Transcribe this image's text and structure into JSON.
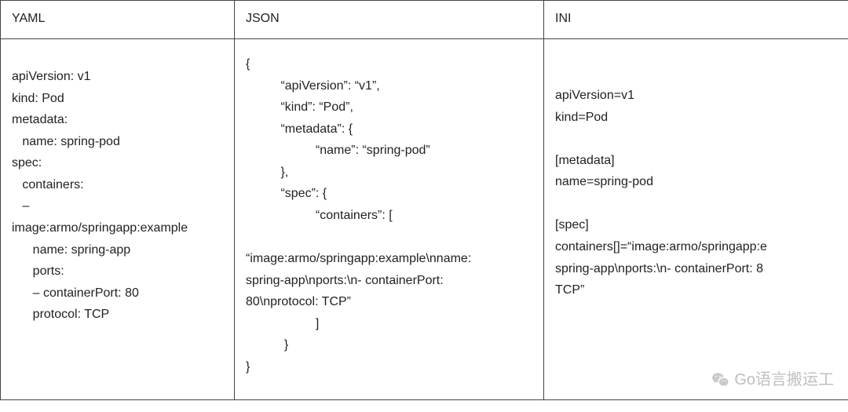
{
  "chart_data": {
    "type": "table",
    "columns": [
      "YAML",
      "JSON",
      "INI"
    ],
    "rows": [
      {
        "yaml": "apiVersion: v1\nkind: Pod\nmetadata:\n   name: spring-pod\nspec:\n   containers:\n   –\nimage:armo/springapp:example\n      name: spring-app\n      ports:\n      – containerPort: 80\n      protocol: TCP",
        "json": "{\n          “apiVersion”: “v1”,\n          “kind”: “Pod”,\n          “metadata”: {\n                    “name”: “spring-pod”\n          },\n          “spec”: {\n                    “containers”: [\n\n“image:armo/springapp:example\\nname:\nspring-app\\nports:\\n- containerPort:\n80\\nprotocol: TCP”\n                    ]\n           }\n}",
        "ini": "apiVersion=v1\nkind=Pod\n\n[metadata]\nname=spring-pod\n\n[spec]\ncontainers[]=“image:armo/springapp:e\nspring-app\\nports:\\n- containerPort: 8\nTCP”"
      }
    ]
  },
  "headers": {
    "col1": "YAML",
    "col2": "JSON",
    "col3": "INI"
  },
  "body": {
    "yaml": "apiVersion: v1\nkind: Pod\nmetadata:\n   name: spring-pod\nspec:\n   containers:\n   –\nimage:armo/springapp:example\n      name: spring-app\n      ports:\n      – containerPort: 80\n      protocol: TCP",
    "json": "{\n          “apiVersion”: “v1”,\n          “kind”: “Pod”,\n          “metadata”: {\n                    “name”: “spring-pod”\n          },\n          “spec”: {\n                    “containers”: [\n\n“image:armo/springapp:example\\nname:\nspring-app\\nports:\\n- containerPort:\n80\\nprotocol: TCP”\n                    ]\n           }\n}",
    "ini": "apiVersion=v1\nkind=Pod\n\n[metadata]\nname=spring-pod\n\n[spec]\ncontainers[]=“image:armo/springapp:e\nspring-app\\nports:\\n- containerPort: 8\nTCP”"
  },
  "watermark": "Go语言搬运工"
}
